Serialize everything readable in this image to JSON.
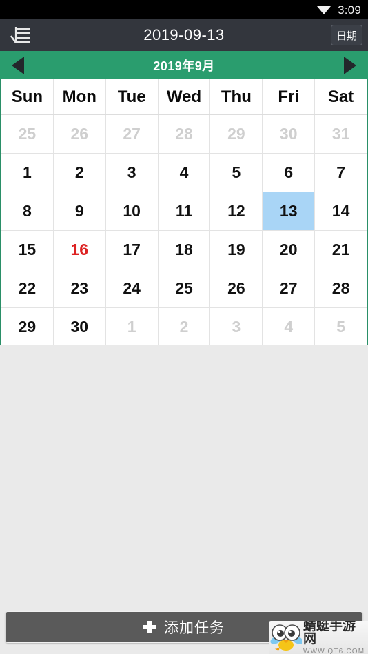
{
  "status_bar": {
    "time": "3:09",
    "wifi_icon": "wifi-icon"
  },
  "app_bar": {
    "menu_icon": "list-menu-icon",
    "title": "2019-09-13",
    "date_button_label": "日期"
  },
  "month_nav": {
    "prev_icon": "triangle-left-icon",
    "next_icon": "triangle-right-icon",
    "month_label": "2019年9月"
  },
  "calendar": {
    "weekday_headers": [
      "Sun",
      "Mon",
      "Tue",
      "Wed",
      "Thu",
      "Fri",
      "Sat"
    ],
    "weeks": [
      [
        {
          "day": "25",
          "state": "muted"
        },
        {
          "day": "26",
          "state": "muted"
        },
        {
          "day": "27",
          "state": "muted"
        },
        {
          "day": "28",
          "state": "muted"
        },
        {
          "day": "29",
          "state": "muted"
        },
        {
          "day": "30",
          "state": "muted"
        },
        {
          "day": "31",
          "state": "muted"
        }
      ],
      [
        {
          "day": "1",
          "state": "normal"
        },
        {
          "day": "2",
          "state": "normal"
        },
        {
          "day": "3",
          "state": "normal"
        },
        {
          "day": "4",
          "state": "normal"
        },
        {
          "day": "5",
          "state": "normal"
        },
        {
          "day": "6",
          "state": "normal"
        },
        {
          "day": "7",
          "state": "normal"
        }
      ],
      [
        {
          "day": "8",
          "state": "normal"
        },
        {
          "day": "9",
          "state": "normal"
        },
        {
          "day": "10",
          "state": "normal"
        },
        {
          "day": "11",
          "state": "normal"
        },
        {
          "day": "12",
          "state": "normal"
        },
        {
          "day": "13",
          "state": "selected"
        },
        {
          "day": "14",
          "state": "normal"
        }
      ],
      [
        {
          "day": "15",
          "state": "normal"
        },
        {
          "day": "16",
          "state": "today"
        },
        {
          "day": "17",
          "state": "normal"
        },
        {
          "day": "18",
          "state": "normal"
        },
        {
          "day": "19",
          "state": "normal"
        },
        {
          "day": "20",
          "state": "normal"
        },
        {
          "day": "21",
          "state": "normal"
        }
      ],
      [
        {
          "day": "22",
          "state": "normal"
        },
        {
          "day": "23",
          "state": "normal"
        },
        {
          "day": "24",
          "state": "normal"
        },
        {
          "day": "25",
          "state": "normal"
        },
        {
          "day": "26",
          "state": "normal"
        },
        {
          "day": "27",
          "state": "normal"
        },
        {
          "day": "28",
          "state": "normal"
        }
      ],
      [
        {
          "day": "29",
          "state": "normal"
        },
        {
          "day": "30",
          "state": "normal"
        },
        {
          "day": "1",
          "state": "muted"
        },
        {
          "day": "2",
          "state": "muted"
        },
        {
          "day": "3",
          "state": "muted"
        },
        {
          "day": "4",
          "state": "muted"
        },
        {
          "day": "5",
          "state": "muted"
        }
      ]
    ]
  },
  "bottom_bar": {
    "add_task_icon": "plus-icon",
    "add_task_label": "添加任务"
  },
  "watermark": {
    "mascot_icon": "dragonfly-mascot-icon",
    "site_name": "蜻蜓手游网",
    "site_url": "WWW.QT6.COM"
  },
  "colors": {
    "status_bar_bg": "#000000",
    "app_bar_bg": "#33363d",
    "accent_green": "#2a9d6e",
    "selected_day_bg": "#a9d5f6",
    "today_text": "#dd2222",
    "page_bg": "#eaeaea",
    "button_bg": "#5a5a5a"
  }
}
